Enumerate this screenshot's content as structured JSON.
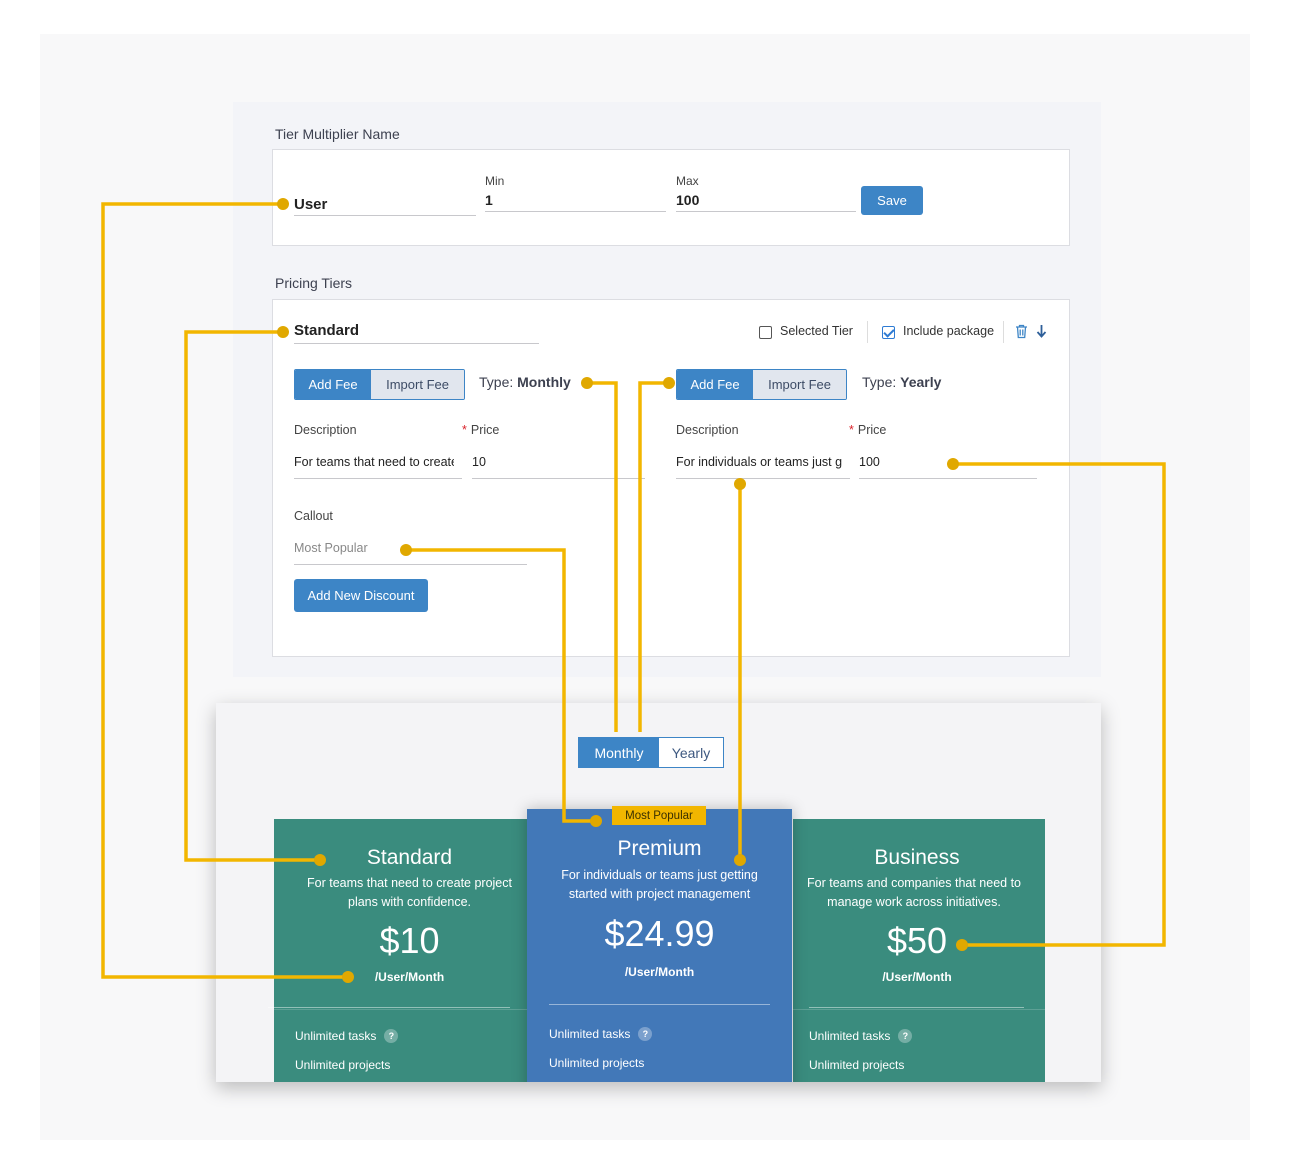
{
  "tier_multiplier": {
    "section_label": "Tier Multiplier Name",
    "name_value": "User",
    "min_label": "Min",
    "min_value": "1",
    "max_label": "Max",
    "max_value": "100",
    "save_label": "Save"
  },
  "pricing_tiers": {
    "section_label": "Pricing Tiers",
    "tier_name": "Standard",
    "selected_tier_label": "Selected Tier",
    "include_package_label": "Include package",
    "monthly": {
      "add_fee_label": "Add Fee",
      "import_fee_label": "Import Fee",
      "type_prefix": "Type:",
      "type_value": "Monthly",
      "description_label": "Description",
      "price_label": "Price",
      "required_mark": "*",
      "description_value": "For teams that need to create",
      "price_value": "10"
    },
    "yearly": {
      "add_fee_label": "Add Fee",
      "import_fee_label": "Import Fee",
      "type_prefix": "Type:",
      "type_value": "Yearly",
      "description_label": "Description",
      "price_label": "Price",
      "required_mark": "*",
      "description_value": "For individuals or teams just g",
      "price_value": "100"
    },
    "callout_label": "Callout",
    "callout_placeholder": "Most Popular",
    "add_discount_label": "Add New Discount"
  },
  "preview": {
    "toggle": {
      "monthly": "Monthly",
      "yearly": "Yearly"
    },
    "badge": "Most Popular",
    "plans": [
      {
        "name": "Standard",
        "description": "For teams that need to create project plans with confidence.",
        "price": "$10",
        "unit": "/User/Month",
        "features": [
          "Unlimited tasks",
          "Unlimited projects"
        ]
      },
      {
        "name": "Premium",
        "description": "For individuals or teams just getting started with project management",
        "price": "$24.99",
        "unit": "/User/Month",
        "features": [
          "Unlimited tasks",
          "Unlimited projects"
        ]
      },
      {
        "name": "Business",
        "description": "For teams and companies that need to manage work across initiatives.",
        "price": "$50",
        "unit": "/User/Month",
        "features": [
          "Unlimited tasks",
          "Unlimited projects"
        ]
      }
    ],
    "help_mark": "?"
  },
  "colors": {
    "accent_blue": "#3d85c6",
    "plan_green": "#3a8c7e",
    "plan_blue": "#4278b8",
    "connector_yellow": "#f2b600"
  },
  "icons": [
    "trash-icon",
    "arrow-down-icon",
    "checkbox-icon",
    "help-icon"
  ]
}
